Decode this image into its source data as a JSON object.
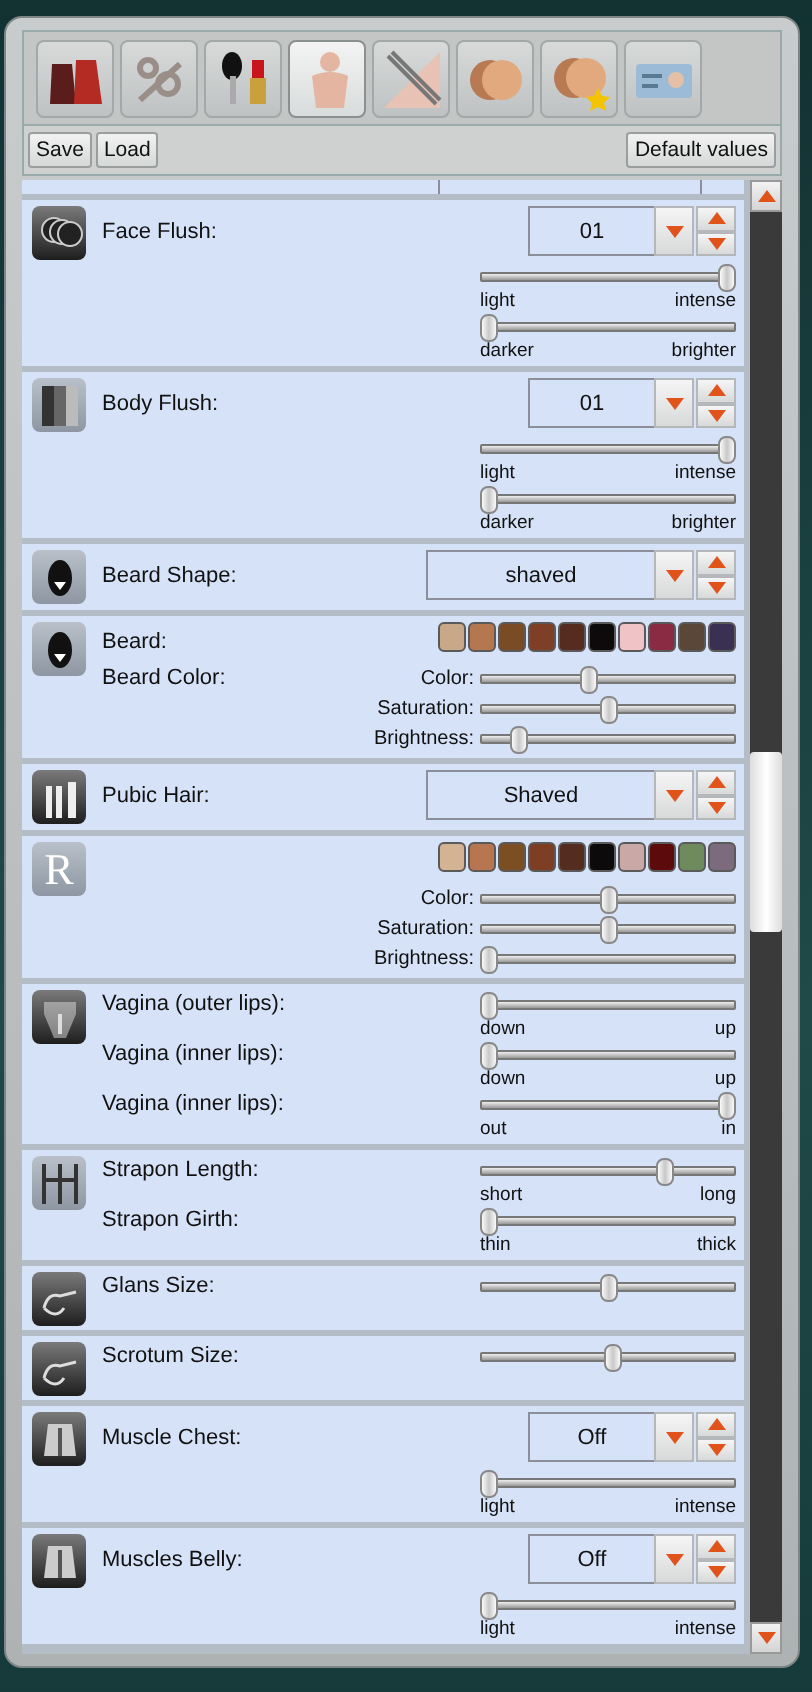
{
  "tabs": [
    {
      "selected": false
    },
    {
      "selected": false
    },
    {
      "selected": false
    },
    {
      "selected": true
    },
    {
      "selected": false
    },
    {
      "selected": false
    },
    {
      "selected": false
    },
    {
      "selected": false
    }
  ],
  "buttons": [
    {
      "label": "Save"
    },
    {
      "label": "Load"
    },
    {
      "label": "Default values"
    }
  ],
  "sections": [
    {
      "rows": [
        {
          "kind": "dropdown",
          "label": "Face Flush:",
          "value": "01"
        },
        {
          "kind": "slider",
          "level": 1,
          "min": "light",
          "max": "intense"
        },
        {
          "kind": "slider",
          "level": 0,
          "min": "darker",
          "max": "brighter"
        }
      ]
    },
    {
      "rows": [
        {
          "kind": "dropdown",
          "label": "Body Flush:",
          "value": "01"
        },
        {
          "kind": "slider",
          "level": 1,
          "min": "light",
          "max": "intense"
        },
        {
          "kind": "slider",
          "level": 0,
          "min": "darker",
          "max": "brighter"
        }
      ]
    },
    {
      "rows": [
        {
          "kind": "dropdown",
          "label": "Beard Shape:",
          "value": "shaved"
        }
      ]
    },
    {
      "rows": [
        {
          "kind": "swatches",
          "label": "Beard:",
          "swatches": [
            {
              "color": "#c9a88a"
            },
            {
              "color": "#b4774f"
            },
            {
              "color": "#7a4c25"
            },
            {
              "color": "#7f3e26"
            },
            {
              "color": "#552c1f"
            },
            {
              "color": "#0c0a0a"
            },
            {
              "color": "#f0c3c7"
            },
            {
              "color": "#8a2a43"
            },
            {
              "color": "#5a4737"
            },
            {
              "color": "#3a3152"
            }
          ]
        },
        {
          "kind": "slider",
          "label": "Beard Color:",
          "caption": "Color:",
          "level": 0.42
        },
        {
          "kind": "slider",
          "caption": "Saturation:",
          "level": 0.5
        },
        {
          "kind": "slider",
          "caption": "Brightness:",
          "level": 0.13
        }
      ]
    },
    {
      "rows": [
        {
          "kind": "dropdown",
          "label": "Pubic Hair:",
          "value": "Shaved"
        }
      ]
    },
    {
      "icon_text": "R",
      "rows": [
        {
          "kind": "swatches",
          "swatches": [
            {
              "color": "#d4b394"
            },
            {
              "color": "#b87650"
            },
            {
              "color": "#7c4f23"
            },
            {
              "color": "#7d3e24"
            },
            {
              "color": "#552d1e"
            },
            {
              "color": "#0c0a0a"
            },
            {
              "color": "#c9a8a6"
            },
            {
              "color": "#5c0a0c"
            },
            {
              "color": "#6f8a5c"
            },
            {
              "color": "#7b6b7d"
            }
          ]
        },
        {
          "kind": "slider",
          "caption": "Color:",
          "level": 0.5
        },
        {
          "kind": "slider",
          "caption": "Saturation:",
          "level": 0.5
        },
        {
          "kind": "slider",
          "caption": "Brightness:",
          "level": 0
        }
      ]
    },
    {
      "rows": [
        {
          "kind": "slider",
          "label": "Vagina (outer lips):",
          "level": 0,
          "min": "down",
          "max": "up"
        },
        {
          "kind": "slider",
          "label": "Vagina (inner lips):",
          "level": 0,
          "min": "down",
          "max": "up"
        },
        {
          "kind": "slider",
          "label": "Vagina (inner lips):",
          "level": 1,
          "min": "out",
          "max": "in"
        }
      ]
    },
    {
      "rows": [
        {
          "kind": "slider",
          "label": "Strapon Length:",
          "level": 0.74,
          "min": "short",
          "max": "long"
        },
        {
          "kind": "slider",
          "label": "Strapon Girth:",
          "level": 0,
          "min": "thin",
          "max": "thick"
        }
      ]
    },
    {
      "rows": [
        {
          "kind": "slider",
          "label": "Glans Size:",
          "level": 0.5
        }
      ]
    },
    {
      "rows": [
        {
          "kind": "slider",
          "label": "Scrotum Size:",
          "level": 0.52
        }
      ]
    },
    {
      "rows": [
        {
          "kind": "dropdown",
          "label": "Muscle Chest:",
          "value": "Off"
        },
        {
          "kind": "slider",
          "level": 0,
          "min": "light",
          "max": "intense"
        }
      ]
    },
    {
      "rows": [
        {
          "kind": "dropdown",
          "label": "Muscles Belly:",
          "value": "Off"
        },
        {
          "kind": "slider",
          "level": 0,
          "min": "light",
          "max": "intense"
        }
      ]
    }
  ]
}
